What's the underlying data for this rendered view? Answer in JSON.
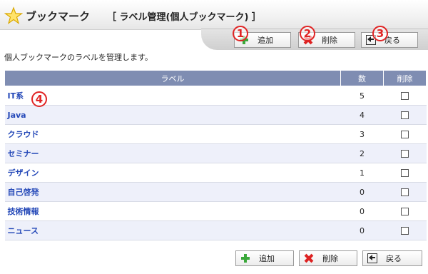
{
  "header": {
    "title": "ブックマーク",
    "subtitle": "［ ラベル管理(個人ブックマーク) ］"
  },
  "toolbar": {
    "add_label": "追加",
    "delete_label": "削除",
    "back_label": "戻る"
  },
  "markers": [
    "1",
    "2",
    "3",
    "4"
  ],
  "description": "個人ブックマークのラベルを管理します。",
  "table": {
    "headers": {
      "label": "ラベル",
      "count": "数",
      "delete": "削除"
    },
    "rows": [
      {
        "label": "IT系",
        "count": "5"
      },
      {
        "label": "Java",
        "count": "4"
      },
      {
        "label": "クラウド",
        "count": "3"
      },
      {
        "label": "セミナー",
        "count": "2"
      },
      {
        "label": "デザイン",
        "count": "1"
      },
      {
        "label": "自己啓発",
        "count": "0"
      },
      {
        "label": "技術情報",
        "count": "0"
      },
      {
        "label": "ニュース",
        "count": "0"
      }
    ]
  },
  "bottom_toolbar": {
    "add_label": "追加",
    "delete_label": "削除",
    "back_label": "戻る"
  },
  "colors": {
    "table_header": "#7f8db2",
    "label_link": "#2448b8",
    "marker": "#e02424"
  }
}
